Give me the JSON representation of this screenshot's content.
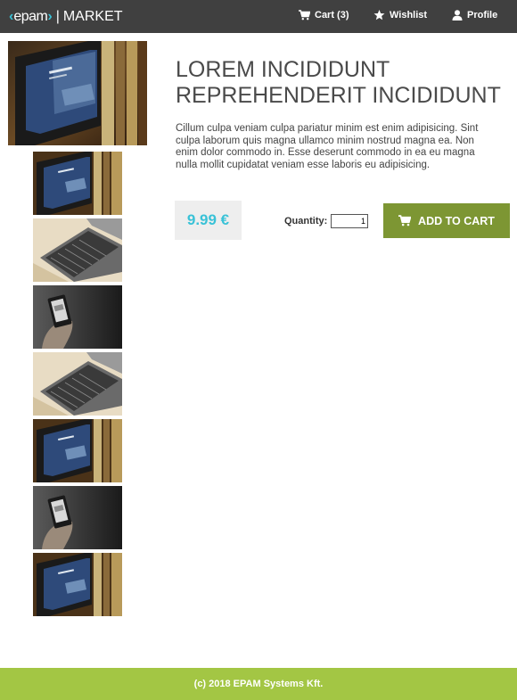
{
  "header": {
    "logo": {
      "lt": "‹",
      "word": "epam",
      "gt": "›"
    },
    "separator": "|",
    "market": "MARKET",
    "nav": {
      "cart": "Cart (3)",
      "wishlist": "Wishlist",
      "profile": "Profile"
    }
  },
  "product": {
    "title": "LOREM INCIDIDUNT REPREHENDERIT INCIDIDUNT",
    "description": "Cillum culpa veniam culpa pariatur minim est enim adipisicing. Sint culpa laborum quis magna ullamco minim nostrud magna ea. Non enim dolor commodo in. Esse deserunt commodo in ea eu magna nulla mollit cupidatat veniam esse laboris eu adipisicing.",
    "price": "9.99 €",
    "quantity_label": "Quantity:",
    "quantity_value": "1",
    "add_to_cart": "ADD TO CART",
    "main_image": "tablet-on-bookshelf",
    "thumbnails": [
      "tablet-on-bookshelf",
      "laptop-keyboard",
      "hand-holding-phone",
      "laptop-keyboard",
      "tablet-on-bookshelf",
      "hand-holding-phone",
      "tablet-on-bookshelf"
    ]
  },
  "footer": {
    "text": "(c) 2018 EPAM Systems Kft."
  },
  "colors": {
    "header_bg": "#404040",
    "accent_cyan": "#39c2d7",
    "button_olive": "#7d9633",
    "footer_green": "#a3c644",
    "price_bg": "#eeeeee"
  },
  "icons": {
    "cart": "cart-icon",
    "wishlist": "star-icon",
    "profile": "user-icon"
  }
}
